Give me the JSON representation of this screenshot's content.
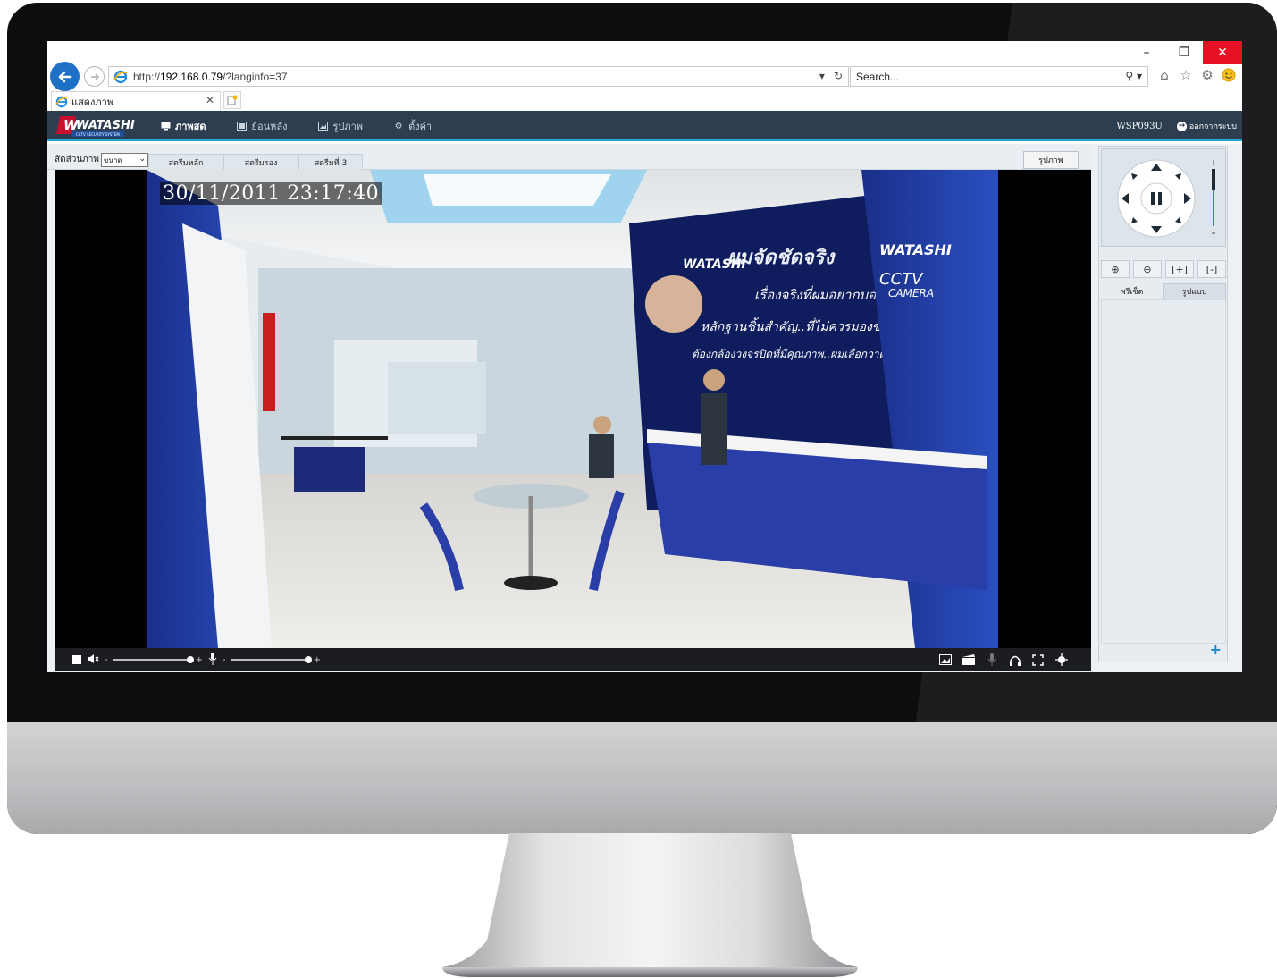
{
  "browser": {
    "url_prefix": "http://",
    "url_host": "192.168.0.79",
    "url_path": "/?langinfo=37",
    "search_placeholder": "Search...",
    "tab_title": "แสดงภาพ",
    "window_controls": [
      "–",
      "❐",
      "✕"
    ]
  },
  "app": {
    "brand": "WATASHI",
    "brand_tagline": "CCTV SECURITY SYSTEM",
    "nav": [
      {
        "label": "ภาพสด",
        "icon": "monitor-icon",
        "active": true
      },
      {
        "label": "ย้อนหลัง",
        "icon": "film-icon",
        "active": false
      },
      {
        "label": "รูปภาพ",
        "icon": "image-icon",
        "active": false
      },
      {
        "label": "ตั้งค่า",
        "icon": "gear-icon",
        "active": false
      }
    ],
    "user": "WSP093U",
    "logout_label": "ออกจากระบบ"
  },
  "view": {
    "ratio_label": "สัดส่วนภาพ",
    "ratio_value": "ขนาด",
    "streams": [
      "สตรีมหลัก",
      "สตรีมรอง",
      "สตรีมที่ 3"
    ],
    "snapshot_label": "รูปภาพ",
    "timestamp": "30/11/2011 23:17:40"
  },
  "player": {
    "volume_minus": "-",
    "volume_plus": "+",
    "mic_minus": "-",
    "mic_plus": "+",
    "volume_level": 1.0,
    "mic_level": 1.0
  },
  "ptz": {
    "tabs": [
      "พรีเซ็ต",
      "รูปแบบ"
    ],
    "add_label": "+"
  },
  "colors": {
    "header_bg": "#2d3e50",
    "accent": "#22a6d8",
    "ie_blue": "#1e6fc6",
    "close_red": "#e81123"
  }
}
